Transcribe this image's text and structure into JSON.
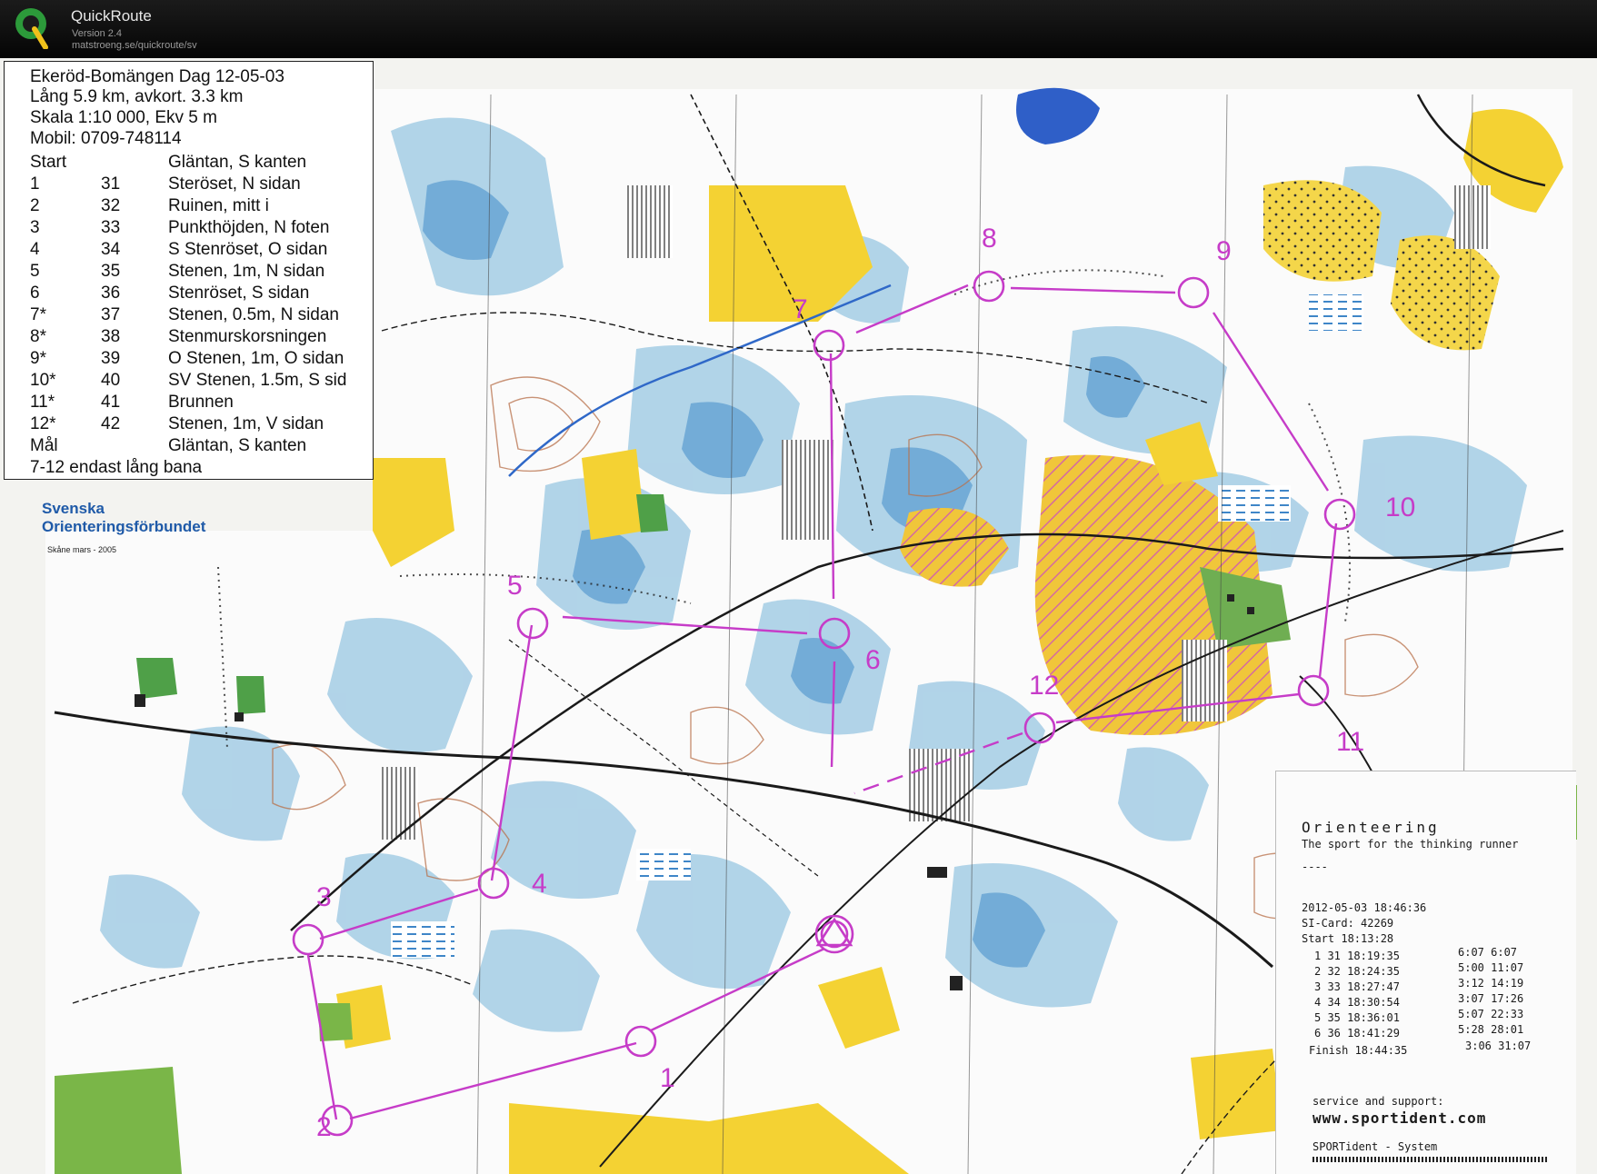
{
  "app": {
    "title": "QuickRoute",
    "version": "Version 2.4",
    "url": "matstroeng.se/quickroute/sv"
  },
  "legend": {
    "title": "Ekeröd-Bomängen Dag 12-05-03",
    "length": "Lång 5.9 km,  avkort. 3.3 km",
    "scale": "Skala 1:10 000, Ekv 5 m",
    "phone": "Mobil: 0709-748114",
    "rows": [
      {
        "n": "Start",
        "code": "",
        "desc": "Gläntan, S kanten"
      },
      {
        "n": "1",
        "code": "31",
        "desc": "Steröset, N sidan"
      },
      {
        "n": "2",
        "code": "32",
        "desc": "Ruinen, mitt i"
      },
      {
        "n": "3",
        "code": "33",
        "desc": "Punkthöjden, N foten"
      },
      {
        "n": "4",
        "code": "34",
        "desc": "S Stenröset, O sidan"
      },
      {
        "n": "5",
        "code": "35",
        "desc": "Stenen, 1m, N sidan"
      },
      {
        "n": "6",
        "code": "36",
        "desc": "Stenröset, S sidan"
      },
      {
        "n": "7*",
        "code": "37",
        "desc": "Stenen, 0.5m, N sidan"
      },
      {
        "n": "8*",
        "code": "38",
        "desc": "Stenmurskorsningen"
      },
      {
        "n": "9*",
        "code": "39",
        "desc": "O Stenen, 1m, O sidan"
      },
      {
        "n": "10*",
        "code": "40",
        "desc": "SV Stenen, 1.5m, S sid"
      },
      {
        "n": "11*",
        "code": "41",
        "desc": "Brunnen"
      },
      {
        "n": "12*",
        "code": "42",
        "desc": "Stenen, 1m, V sidan"
      },
      {
        "n": "Mål",
        "code": "",
        "desc": "Gläntan, S kanten"
      }
    ],
    "note": "7-12 endast lång bana"
  },
  "sof": {
    "line1": "Svenska",
    "line2": "Orienteringsförbundet",
    "sub": "Skåne  mars - 2005"
  },
  "course": {
    "color": "#c63cc8",
    "controls": [
      {
        "label": "1"
      },
      {
        "label": "2"
      },
      {
        "label": "3"
      },
      {
        "label": "4"
      },
      {
        "label": "5"
      },
      {
        "label": "6"
      },
      {
        "label": "7"
      },
      {
        "label": "8"
      },
      {
        "label": "9"
      },
      {
        "label": "10"
      },
      {
        "label": "11"
      },
      {
        "label": "12"
      }
    ]
  },
  "receipt": {
    "title": "Orienteering",
    "subtitle": "The sport for the thinking runner",
    "dashes": "----",
    "datetime": "2012-05-03  18:46:36",
    "si_card": "SI-Card:    42269",
    "start": "Start        18:13:28",
    "splits": [
      {
        "main": "1    31 18:19:35",
        "split": "6:07   6:07"
      },
      {
        "main": "2    32 18:24:35",
        "split": "5:00  11:07"
      },
      {
        "main": "3    33 18:27:47",
        "split": "3:12  14:19"
      },
      {
        "main": "4    34 18:30:54",
        "split": "3:07  17:26"
      },
      {
        "main": "5    35 18:36:01",
        "split": "5:07  22:33"
      },
      {
        "main": "6    36 18:41:29",
        "split": "5:28  28:01"
      }
    ],
    "finish": "Finish    18:44:35",
    "finish_split": "3:06  31:07",
    "service": "service and support:",
    "web": "www.sportident.com",
    "system": "SPORTident - System"
  }
}
